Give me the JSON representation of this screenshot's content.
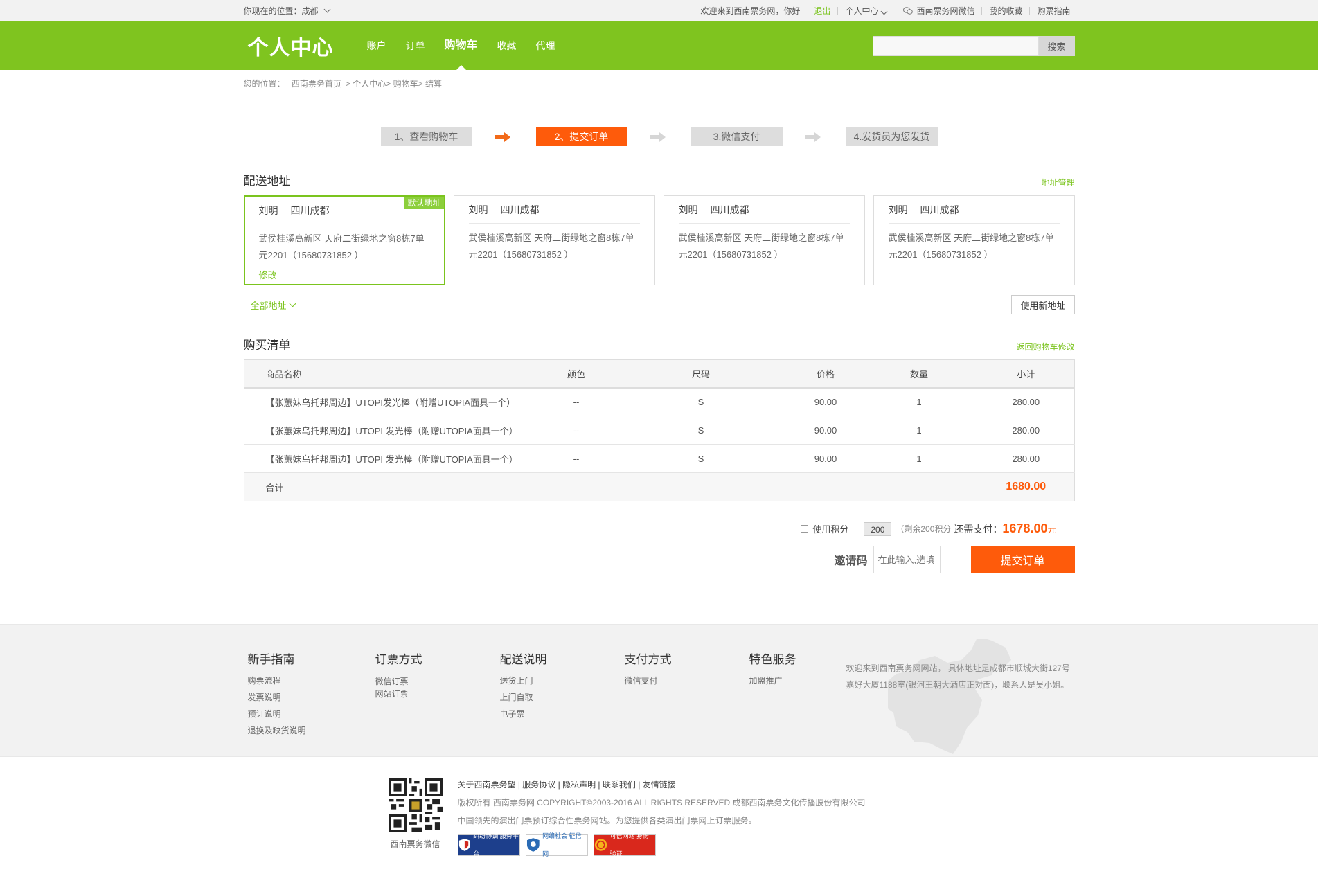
{
  "topbar": {
    "location_label": "你现在的位置：成都",
    "welcome": "欢迎来到西南票务网，你好",
    "logout": "退出",
    "user_center": "个人中心",
    "wechat": "西南票务网微信",
    "favorites": "我的收藏",
    "guide": "购票指南"
  },
  "header": {
    "logo": "个人中心",
    "nav": [
      "账户",
      "订单",
      "购物车",
      "收藏",
      "代理"
    ],
    "active_nav": "购物车",
    "search_button": "搜索",
    "search_placeholder": ""
  },
  "breadcrumb": {
    "label": "您的位置：",
    "items": [
      "西南票务首页",
      "个人中心",
      "购物车",
      "结算"
    ]
  },
  "steps": [
    "1、查看购物车",
    "2、提交订单",
    "3.微信支付",
    "4.发货员为您发货"
  ],
  "current_step": 2,
  "address": {
    "title": "配送地址",
    "manage_link": "地址管理",
    "default_tag": "默认地址",
    "edit_label": "修改",
    "cards": [
      {
        "name": "刘明",
        "city": "四川成都",
        "detail": "武侯桂溪高新区 天府二街绿地之窗8栋7单元2201（15680731852 ）",
        "default": true
      },
      {
        "name": "刘明",
        "city": "四川成都",
        "detail": "武侯桂溪高新区 天府二街绿地之窗8栋7单元2201（15680731852 ）",
        "default": false
      },
      {
        "name": "刘明",
        "city": "四川成都",
        "detail": "武侯桂溪高新区 天府二街绿地之窗8栋7单元2201（15680731852 ）",
        "default": false
      },
      {
        "name": "刘明",
        "city": "四川成都",
        "detail": "武侯桂溪高新区 天府二街绿地之窗8栋7单元2201（15680731852 ）",
        "default": false
      }
    ],
    "all_link": "全部地址",
    "new_button": "使用新地址"
  },
  "cart": {
    "title": "购买清单",
    "back_link": "返回购物车修改",
    "columns": [
      "商品名称",
      "颜色",
      "尺码",
      "价格",
      "数量",
      "小计"
    ],
    "rows": [
      [
        "【张蕙妹乌托邦周边】UTOPI发光棒（附赠UTOPIA面具一个）",
        "--",
        "S",
        "90.00",
        "1",
        "280.00"
      ],
      [
        "【张蕙妹乌托邦周边】UTOPI 发光棒（附赠UTOPIA面具一个）",
        "--",
        "S",
        "90.00",
        "1",
        "280.00"
      ],
      [
        "【张蕙妹乌托邦周边】UTOPI 发光棒（附赠UTOPIA面具一个）",
        "--",
        "S",
        "90.00",
        "1",
        "280.00"
      ]
    ],
    "total_label": "合计",
    "total_value": "1680.00"
  },
  "payment": {
    "use_points_label": "使用积分",
    "points_value": "200",
    "remaining": "（剩余200积分",
    "need_label": "还需支付：",
    "need_amount": "1678.00",
    "unit": "元",
    "invite_label": "邀请码",
    "invite_placeholder": "在此输入,选填",
    "submit": "提交订单"
  },
  "footer": {
    "columns": [
      {
        "title": "新手指南",
        "items": [
          "购票流程",
          "发票说明",
          "预订说明",
          "退换及缺货说明"
        ]
      },
      {
        "title": "订票方式",
        "items": [
          "微信订票",
          "网站订票"
        ]
      },
      {
        "title": "配送说明",
        "items": [
          "送货上门",
          "上门自取",
          "电子票"
        ]
      },
      {
        "title": "支付方式",
        "items": [
          "微信支付"
        ]
      },
      {
        "title": "特色服务",
        "items": [
          "加盟推广"
        ]
      }
    ],
    "about": "欢迎来到西南票务网网站， 具体地址是成都市顺城大街127号嘉好大厦1188室(银河王朝大酒店正对面)，联系人是吴小姐。",
    "links": "关于西南票务望 | 服务协议 | 隐私声明 | 联系我们 | 友情链接",
    "copyright": "版权所有 西南票务网 COPYRIGHT©2003-2016 ALL RIGHTS RESERVED 成都西南票务文化传播股份有限公司",
    "slogan": "中国领先的演出门票预订综合性票务网站。为您提供各类演出门票网上订票服务。",
    "qr_label": "西南票务微信",
    "badges": [
      "纠纷协调 服务平台",
      "网络社会 征信网",
      "可信网站 身份验证"
    ]
  }
}
